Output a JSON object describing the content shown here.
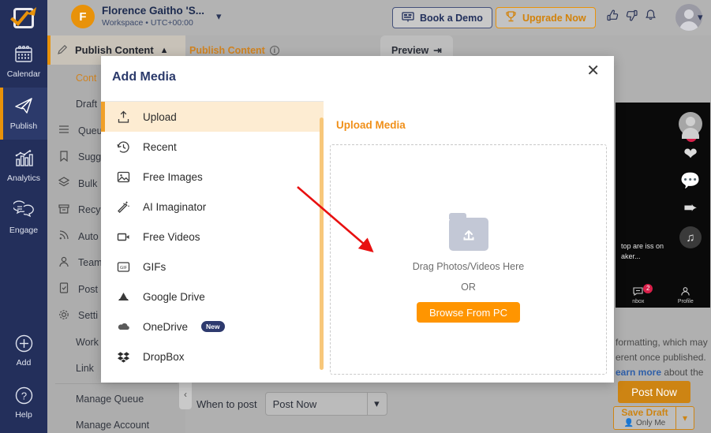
{
  "header": {
    "workspace_name": "Florence Gaitho 'S...",
    "workspace_sub": "Workspace • UTC+00:00",
    "avatar_initial": "F",
    "book_demo_label": "Book a Demo",
    "upgrade_label": "Upgrade Now"
  },
  "rail": {
    "items": [
      {
        "label": "Calendar",
        "icon": "calendar-icon"
      },
      {
        "label": "Publish",
        "icon": "paper-plane-icon"
      },
      {
        "label": "Analytics",
        "icon": "bar-chart-icon"
      },
      {
        "label": "Engage",
        "icon": "chat-bubbles-icon"
      }
    ],
    "bottom": [
      {
        "label": "Add",
        "icon": "plus-circle-icon"
      },
      {
        "label": "Help",
        "icon": "question-circle-icon"
      }
    ]
  },
  "sidebar": {
    "header": "Publish Content",
    "items": [
      {
        "label": "Cont",
        "accent": true,
        "indent": true
      },
      {
        "label": "Draft",
        "accent": false,
        "indent": true
      },
      {
        "label": "Queu",
        "accent": false,
        "indent": false,
        "icon": "list-icon"
      },
      {
        "label": "Sugg",
        "accent": false,
        "indent": false,
        "icon": "bookmark-icon"
      },
      {
        "label": "Bulk",
        "accent": false,
        "indent": false,
        "icon": "layers-icon"
      },
      {
        "label": "Recy",
        "accent": false,
        "indent": false,
        "icon": "archive-icon"
      },
      {
        "label": "Auto",
        "accent": false,
        "indent": false,
        "icon": "rss-icon"
      },
      {
        "label": "Team",
        "accent": false,
        "indent": false,
        "icon": "person-icon"
      },
      {
        "label": "Post",
        "accent": false,
        "indent": false,
        "icon": "file-check-icon"
      },
      {
        "label": "Setti",
        "accent": false,
        "indent": false,
        "icon": "gear-icon"
      },
      {
        "label": "Work",
        "accent": false,
        "indent": true
      },
      {
        "label": "Link",
        "accent": false,
        "indent": true
      }
    ],
    "footer_items": [
      "Manage Queue",
      "Manage Account"
    ]
  },
  "main": {
    "tab_publish": "Publish Content",
    "tab_preview": "Preview",
    "note_line1": "formatting, which may",
    "note_line2": "erent once published.",
    "note_link": "earn more",
    "note_line3": " about the",
    "when_to_post_label": "When to post",
    "when_to_post_value": "Post Now",
    "post_now_label": "Post Now",
    "save_draft_label": "Save Draft",
    "save_draft_sub": "Only Me"
  },
  "preview": {
    "caption": "top are iss on aker...",
    "nav": [
      {
        "label": "nbox",
        "badge": "2"
      },
      {
        "label": "Profile",
        "badge": ""
      }
    ]
  },
  "modal": {
    "title": "Add Media",
    "close_icon": "close-icon",
    "menu": [
      {
        "label": "Upload",
        "icon": "upload-icon",
        "active": true,
        "badge": ""
      },
      {
        "label": "Recent",
        "icon": "clock-history-icon",
        "active": false,
        "badge": ""
      },
      {
        "label": "Free Images",
        "icon": "image-icon",
        "active": false,
        "badge": ""
      },
      {
        "label": "AI Imaginator",
        "icon": "magic-wand-icon",
        "active": false,
        "badge": ""
      },
      {
        "label": "Free Videos",
        "icon": "video-camera-icon",
        "active": false,
        "badge": ""
      },
      {
        "label": "GIFs",
        "icon": "gif-icon",
        "active": false,
        "badge": ""
      },
      {
        "label": "Google Drive",
        "icon": "google-drive-icon",
        "active": false,
        "badge": ""
      },
      {
        "label": "OneDrive",
        "icon": "onedrive-cloud-icon",
        "active": false,
        "badge": "New"
      },
      {
        "label": "DropBox",
        "icon": "dropbox-icon",
        "active": false,
        "badge": ""
      }
    ],
    "panel_title": "Upload Media",
    "drag_text": "Drag Photos/Videos Here",
    "or_text": "OR",
    "browse_label": "Browse From PC"
  },
  "colors": {
    "brand_navy": "#232f5b",
    "accent_orange": "#e8920a",
    "button_orange": "#ff9500",
    "highlight_bg": "#fdecd2",
    "annotation_red": "#e81010"
  }
}
